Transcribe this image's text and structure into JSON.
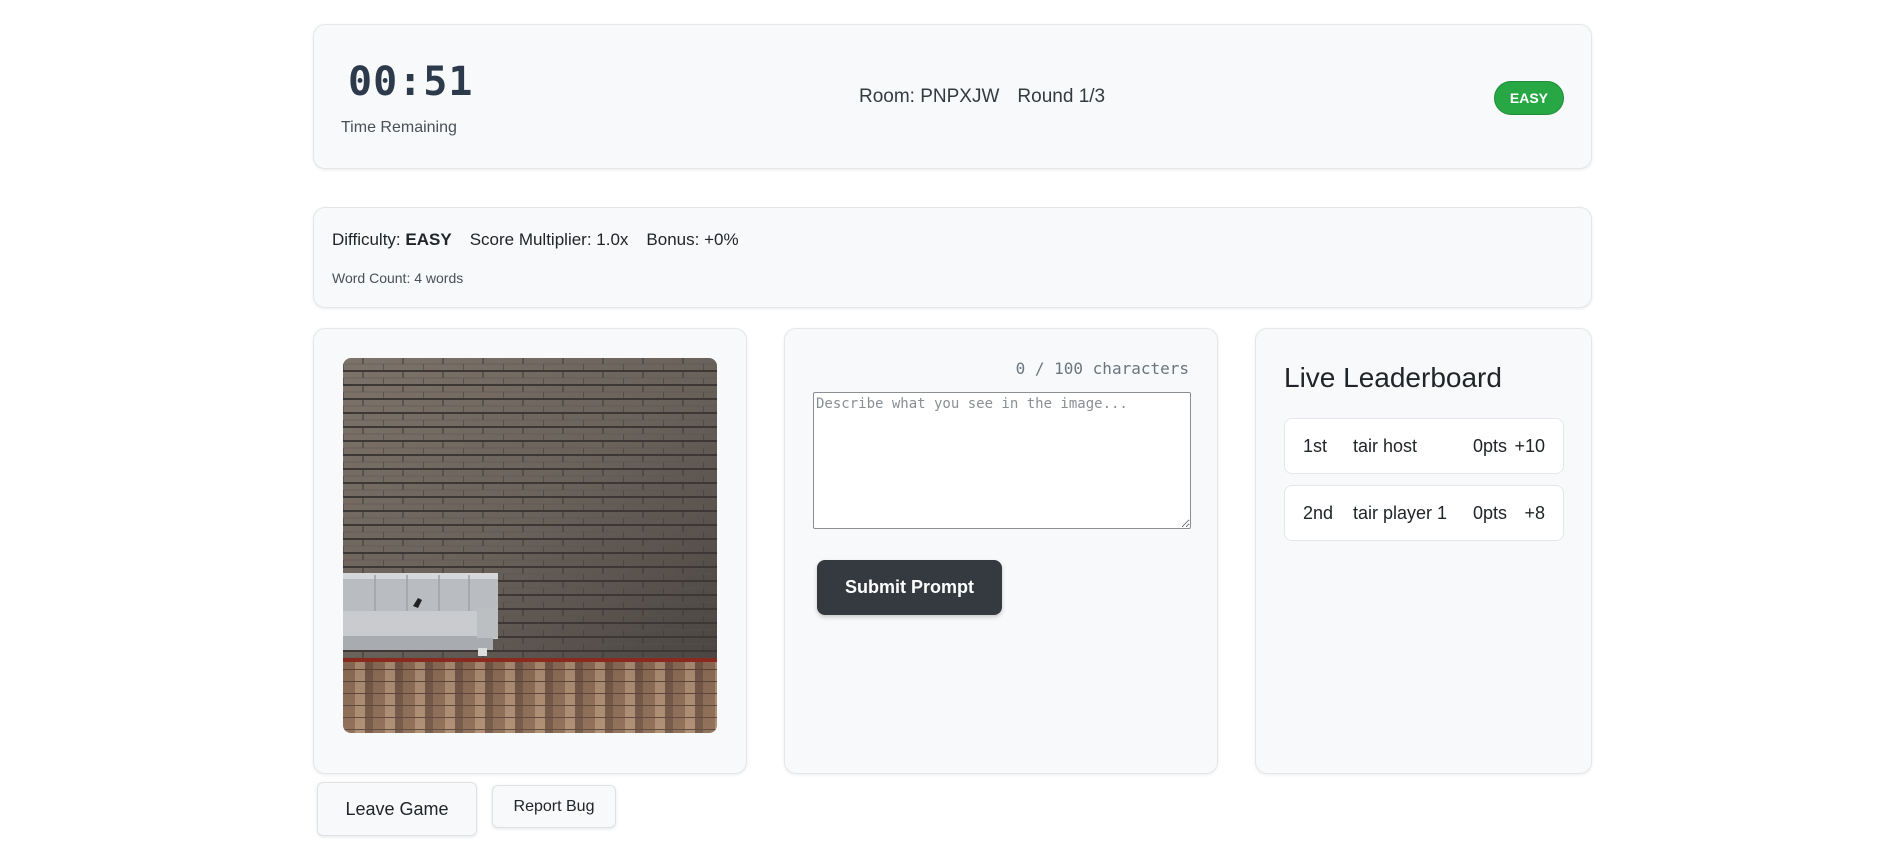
{
  "header": {
    "timer": "00:51",
    "timer_label": "Time Remaining",
    "room": "Room: PNPXJW",
    "round": "Round 1/3",
    "difficulty_badge": "EASY",
    "badge_color": "#28a745"
  },
  "info": {
    "difficulty_label": "Difficulty:",
    "difficulty_value": "EASY",
    "multiplier": "Score Multiplier: 1.0x",
    "bonus": "Bonus: +0%",
    "word_count": "Word Count: 4 words"
  },
  "image_panel": {
    "image_description_icon": "couch-brick-wall-image"
  },
  "prompt_panel": {
    "char_count": "0 / 100 characters",
    "placeholder": "Describe what you see in the image...",
    "value": "",
    "submit_label": "Submit Prompt"
  },
  "leaderboard": {
    "title": "Live Leaderboard",
    "entries": [
      {
        "rank": "1st",
        "name": "tair host",
        "points": "0pts",
        "bonus": "+10"
      },
      {
        "rank": "2nd",
        "name": "tair player 1",
        "points": "0pts",
        "bonus": "+8"
      }
    ]
  },
  "footer": {
    "leave_label": "Leave Game",
    "report_label": "Report Bug"
  }
}
